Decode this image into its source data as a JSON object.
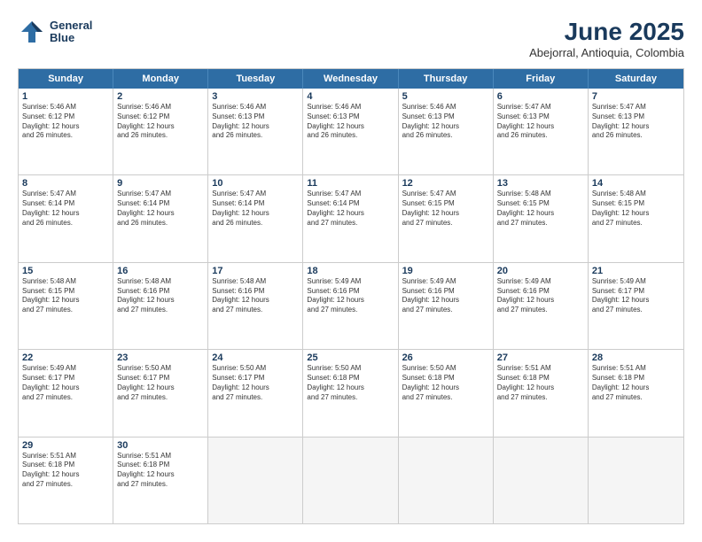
{
  "header": {
    "logo_line1": "General",
    "logo_line2": "Blue",
    "month_year": "June 2025",
    "location": "Abejorral, Antioquia, Colombia"
  },
  "days_of_week": [
    "Sunday",
    "Monday",
    "Tuesday",
    "Wednesday",
    "Thursday",
    "Friday",
    "Saturday"
  ],
  "rows": [
    [
      {
        "day": "1",
        "lines": [
          "Sunrise: 5:46 AM",
          "Sunset: 6:12 PM",
          "Daylight: 12 hours",
          "and 26 minutes."
        ]
      },
      {
        "day": "2",
        "lines": [
          "Sunrise: 5:46 AM",
          "Sunset: 6:12 PM",
          "Daylight: 12 hours",
          "and 26 minutes."
        ]
      },
      {
        "day": "3",
        "lines": [
          "Sunrise: 5:46 AM",
          "Sunset: 6:13 PM",
          "Daylight: 12 hours",
          "and 26 minutes."
        ]
      },
      {
        "day": "4",
        "lines": [
          "Sunrise: 5:46 AM",
          "Sunset: 6:13 PM",
          "Daylight: 12 hours",
          "and 26 minutes."
        ]
      },
      {
        "day": "5",
        "lines": [
          "Sunrise: 5:46 AM",
          "Sunset: 6:13 PM",
          "Daylight: 12 hours",
          "and 26 minutes."
        ]
      },
      {
        "day": "6",
        "lines": [
          "Sunrise: 5:47 AM",
          "Sunset: 6:13 PM",
          "Daylight: 12 hours",
          "and 26 minutes."
        ]
      },
      {
        "day": "7",
        "lines": [
          "Sunrise: 5:47 AM",
          "Sunset: 6:13 PM",
          "Daylight: 12 hours",
          "and 26 minutes."
        ]
      }
    ],
    [
      {
        "day": "8",
        "lines": [
          "Sunrise: 5:47 AM",
          "Sunset: 6:14 PM",
          "Daylight: 12 hours",
          "and 26 minutes."
        ]
      },
      {
        "day": "9",
        "lines": [
          "Sunrise: 5:47 AM",
          "Sunset: 6:14 PM",
          "Daylight: 12 hours",
          "and 26 minutes."
        ]
      },
      {
        "day": "10",
        "lines": [
          "Sunrise: 5:47 AM",
          "Sunset: 6:14 PM",
          "Daylight: 12 hours",
          "and 26 minutes."
        ]
      },
      {
        "day": "11",
        "lines": [
          "Sunrise: 5:47 AM",
          "Sunset: 6:14 PM",
          "Daylight: 12 hours",
          "and 27 minutes."
        ]
      },
      {
        "day": "12",
        "lines": [
          "Sunrise: 5:47 AM",
          "Sunset: 6:15 PM",
          "Daylight: 12 hours",
          "and 27 minutes."
        ]
      },
      {
        "day": "13",
        "lines": [
          "Sunrise: 5:48 AM",
          "Sunset: 6:15 PM",
          "Daylight: 12 hours",
          "and 27 minutes."
        ]
      },
      {
        "day": "14",
        "lines": [
          "Sunrise: 5:48 AM",
          "Sunset: 6:15 PM",
          "Daylight: 12 hours",
          "and 27 minutes."
        ]
      }
    ],
    [
      {
        "day": "15",
        "lines": [
          "Sunrise: 5:48 AM",
          "Sunset: 6:15 PM",
          "Daylight: 12 hours",
          "and 27 minutes."
        ]
      },
      {
        "day": "16",
        "lines": [
          "Sunrise: 5:48 AM",
          "Sunset: 6:16 PM",
          "Daylight: 12 hours",
          "and 27 minutes."
        ]
      },
      {
        "day": "17",
        "lines": [
          "Sunrise: 5:48 AM",
          "Sunset: 6:16 PM",
          "Daylight: 12 hours",
          "and 27 minutes."
        ]
      },
      {
        "day": "18",
        "lines": [
          "Sunrise: 5:49 AM",
          "Sunset: 6:16 PM",
          "Daylight: 12 hours",
          "and 27 minutes."
        ]
      },
      {
        "day": "19",
        "lines": [
          "Sunrise: 5:49 AM",
          "Sunset: 6:16 PM",
          "Daylight: 12 hours",
          "and 27 minutes."
        ]
      },
      {
        "day": "20",
        "lines": [
          "Sunrise: 5:49 AM",
          "Sunset: 6:16 PM",
          "Daylight: 12 hours",
          "and 27 minutes."
        ]
      },
      {
        "day": "21",
        "lines": [
          "Sunrise: 5:49 AM",
          "Sunset: 6:17 PM",
          "Daylight: 12 hours",
          "and 27 minutes."
        ]
      }
    ],
    [
      {
        "day": "22",
        "lines": [
          "Sunrise: 5:49 AM",
          "Sunset: 6:17 PM",
          "Daylight: 12 hours",
          "and 27 minutes."
        ]
      },
      {
        "day": "23",
        "lines": [
          "Sunrise: 5:50 AM",
          "Sunset: 6:17 PM",
          "Daylight: 12 hours",
          "and 27 minutes."
        ]
      },
      {
        "day": "24",
        "lines": [
          "Sunrise: 5:50 AM",
          "Sunset: 6:17 PM",
          "Daylight: 12 hours",
          "and 27 minutes."
        ]
      },
      {
        "day": "25",
        "lines": [
          "Sunrise: 5:50 AM",
          "Sunset: 6:18 PM",
          "Daylight: 12 hours",
          "and 27 minutes."
        ]
      },
      {
        "day": "26",
        "lines": [
          "Sunrise: 5:50 AM",
          "Sunset: 6:18 PM",
          "Daylight: 12 hours",
          "and 27 minutes."
        ]
      },
      {
        "day": "27",
        "lines": [
          "Sunrise: 5:51 AM",
          "Sunset: 6:18 PM",
          "Daylight: 12 hours",
          "and 27 minutes."
        ]
      },
      {
        "day": "28",
        "lines": [
          "Sunrise: 5:51 AM",
          "Sunset: 6:18 PM",
          "Daylight: 12 hours",
          "and 27 minutes."
        ]
      }
    ],
    [
      {
        "day": "29",
        "lines": [
          "Sunrise: 5:51 AM",
          "Sunset: 6:18 PM",
          "Daylight: 12 hours",
          "and 27 minutes."
        ]
      },
      {
        "day": "30",
        "lines": [
          "Sunrise: 5:51 AM",
          "Sunset: 6:18 PM",
          "Daylight: 12 hours",
          "and 27 minutes."
        ]
      },
      {
        "day": "",
        "lines": []
      },
      {
        "day": "",
        "lines": []
      },
      {
        "day": "",
        "lines": []
      },
      {
        "day": "",
        "lines": []
      },
      {
        "day": "",
        "lines": []
      }
    ]
  ]
}
